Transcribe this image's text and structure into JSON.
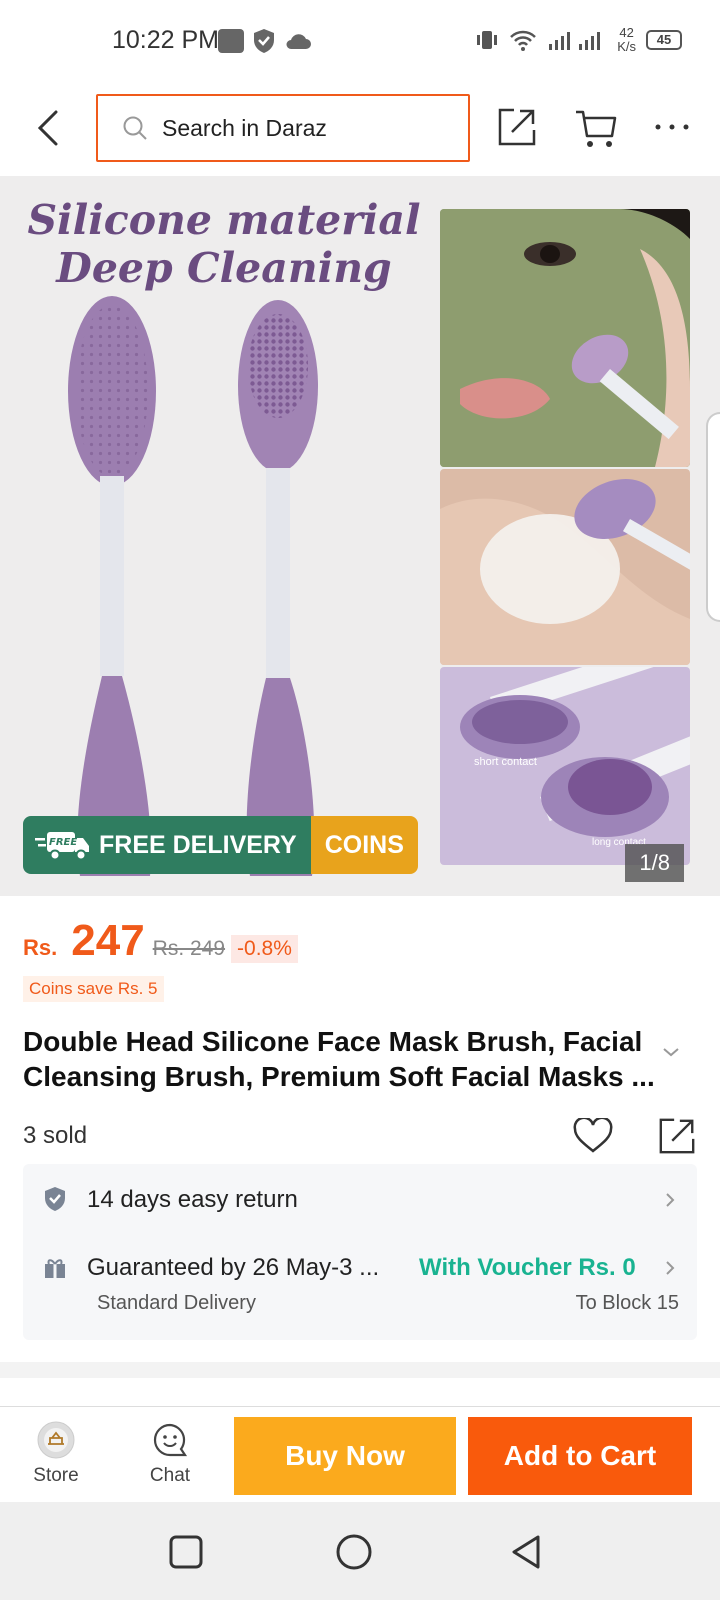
{
  "status_bar": {
    "time": "10:22 PM",
    "net_speed_value": "42",
    "net_speed_unit": "K/s",
    "battery": "45"
  },
  "top_bar": {
    "search_placeholder": "Search in Daraz"
  },
  "gallery": {
    "headline_line1": "Silicone material",
    "headline_line2": "Deep Cleaning",
    "photo_label_1": "short contact",
    "photo_label_2": "long contact",
    "banner_free_tag": "FREE",
    "banner_free_delivery": "FREE DELIVERY",
    "banner_coins": "COINS",
    "page_counter": "1/8",
    "colors": {
      "brush_purple": "#9c7eb0",
      "title_purple": "#6a4c80",
      "banner_green": "#2f7d60",
      "banner_gold": "#e8a31c"
    }
  },
  "product": {
    "currency": "Rs.",
    "price": "247",
    "old_price": "Rs. 249",
    "discount": "-0.8%",
    "coins_save": "Coins save Rs. 5",
    "title": "Double Head Silicone Face Mask Brush, Facial Cleansing Brush, Premium Soft Facial Masks ...",
    "sold": "3 sold"
  },
  "service": {
    "return_text": "14 days easy return",
    "delivery_text": "Guaranteed by 26 May-3 ...",
    "voucher_text": "With Voucher Rs. 0",
    "delivery_type": "Standard Delivery",
    "location": "To Block 15"
  },
  "action_bar": {
    "store_label": "Store",
    "chat_label": "Chat",
    "buy_now": "Buy Now",
    "add_to_cart": "Add to Cart"
  },
  "icons": [
    "back-icon",
    "search-icon",
    "share-icon",
    "cart-icon",
    "more-icon",
    "heart-icon",
    "shield-icon",
    "gift-icon",
    "chevron-right-icon",
    "chat-icon",
    "store-icon",
    "square-icon",
    "circle-icon",
    "triangle-back-icon"
  ],
  "theme": {
    "accent": "#f05a1a",
    "buy_now": "#fbaa1d",
    "add_to_cart": "#f95a0c",
    "voucher_green": "#19b391"
  }
}
